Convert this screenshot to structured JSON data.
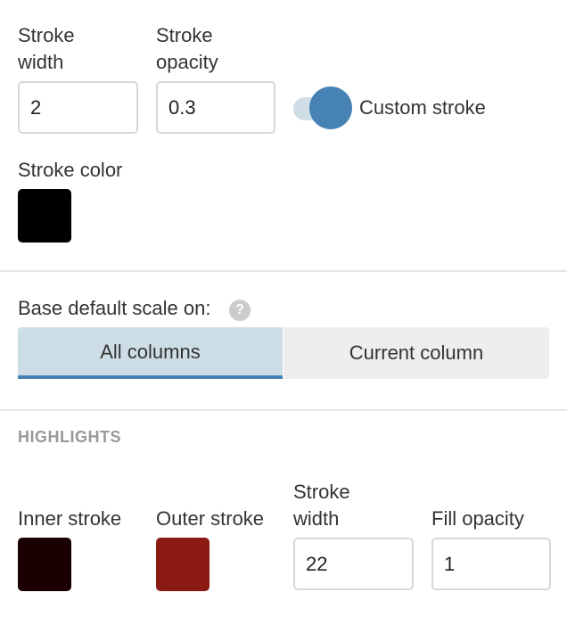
{
  "stroke": {
    "width_label_line1": "Stroke",
    "width_label_line2": "width",
    "width_value": "2",
    "opacity_label_line1": "Stroke",
    "opacity_label_line2": "opacity",
    "opacity_value": "0.3",
    "custom_stroke_label": "Custom stroke",
    "custom_stroke_on": true,
    "color_label": "Stroke color",
    "color": "#000000"
  },
  "scale": {
    "label": "Base default scale on:",
    "help_glyph": "?",
    "options": [
      {
        "label": "All columns",
        "active": true
      },
      {
        "label": "Current column",
        "active": false
      }
    ]
  },
  "highlights": {
    "heading": "HIGHLIGHTS",
    "inner_stroke_label": "Inner stroke",
    "inner_stroke_color": "#1a0000",
    "outer_stroke_label": "Outer stroke",
    "outer_stroke_color": "#8b1a12",
    "stroke_width_label_line1": "Stroke",
    "stroke_width_label_line2": "width",
    "stroke_width_value": "22",
    "fill_opacity_label": "Fill opacity",
    "fill_opacity_value": "1"
  },
  "colors": {
    "accent": "#4682b4",
    "toggle_track": "#cfdde6",
    "segment_active_bg": "#cddde6",
    "segment_inactive_bg": "#eeeeee"
  }
}
